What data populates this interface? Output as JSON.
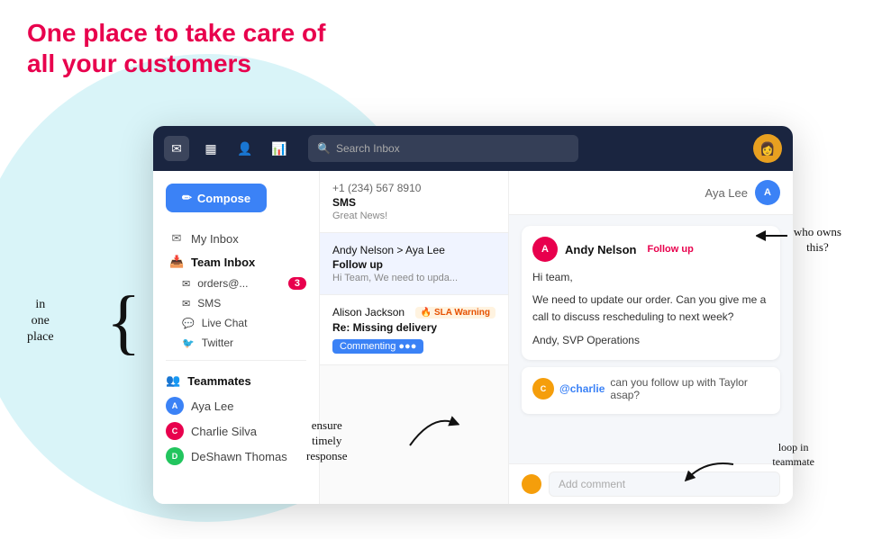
{
  "heading": {
    "line1": "One place to take care of",
    "line2": "all your customers"
  },
  "annotations": {
    "in_one_place": "in\none\nplace",
    "ensure_timely": "ensure\ntimely\nresponse",
    "who_owns": "who owns\nthis?",
    "loop_in": "loop in\nteammate"
  },
  "nav": {
    "search_placeholder": "Search Inbox",
    "icons": [
      "✉",
      "▦",
      "👤",
      "📊"
    ]
  },
  "sidebar": {
    "compose_label": "Compose",
    "my_inbox_label": "My Inbox",
    "team_inbox_label": "Team Inbox",
    "sub_items": [
      {
        "icon": "✉",
        "label": "orders@...",
        "badge": "3"
      },
      {
        "icon": "✉",
        "label": "SMS",
        "badge": null
      },
      {
        "icon": "💬",
        "label": "Live Chat",
        "badge": null
      },
      {
        "icon": "🐦",
        "label": "Twitter",
        "badge": null
      }
    ],
    "teammates_label": "Teammates",
    "teammates": [
      {
        "name": "Aya Lee",
        "color": "#3b82f6",
        "initial": "A"
      },
      {
        "name": "Charlie Silva",
        "color": "#e8004d",
        "initial": "C"
      },
      {
        "name": "DeShawn Thomas",
        "color": "#22c55e",
        "initial": "D"
      }
    ]
  },
  "messages": [
    {
      "phone": "+1 (234) 567 8910",
      "type": "SMS",
      "text": "Great News!"
    },
    {
      "sender": "Andy Nelson > Aya Lee",
      "subject": "Follow up",
      "snippet": "Hi Team, We need to upda..."
    },
    {
      "sender": "Alison Jackson",
      "sla": "SLA Warning",
      "subject": "Re: Missing delivery",
      "status": "Commenting"
    }
  ],
  "conversation": {
    "assignee": "Aya Lee",
    "message": {
      "sender": "Andy Nelson",
      "tag": "Follow up",
      "greeting": "Hi team,",
      "body": "We need to update our order. Can you give me a call to discuss rescheduling to next week?",
      "signature": "Andy, SVP Operations"
    },
    "comment": {
      "mention": "@charlie",
      "text": " can you follow up with Taylor asap?"
    },
    "add_comment_placeholder": "Add comment"
  }
}
